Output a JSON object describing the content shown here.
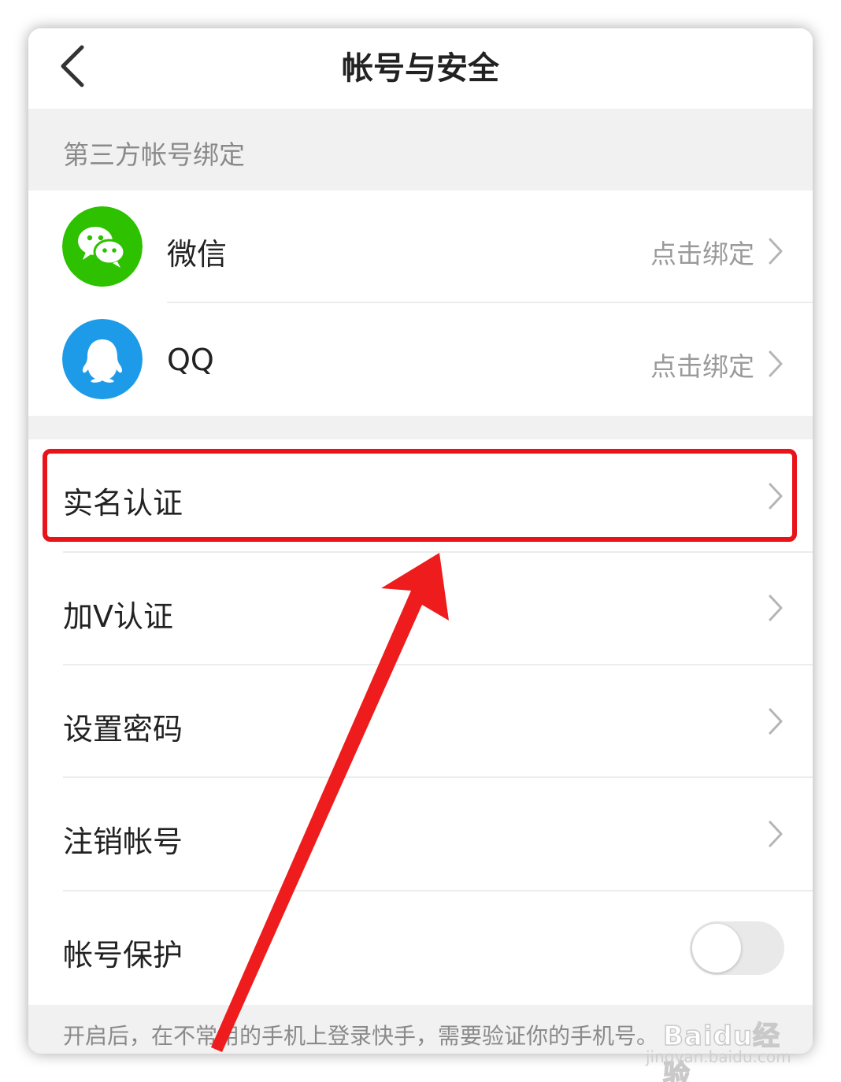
{
  "header": {
    "title": "帐号与安全"
  },
  "third_party": {
    "section_title": "第三方帐号绑定",
    "items": [
      {
        "label": "微信",
        "action": "点击绑定",
        "icon": "wechat-icon",
        "color": "#2dc100"
      },
      {
        "label": "QQ",
        "action": "点击绑定",
        "icon": "qq-icon",
        "color": "#1e9be8"
      }
    ]
  },
  "settings": {
    "items": [
      {
        "label": "实名认证"
      },
      {
        "label": "加V认证"
      },
      {
        "label": "设置密码"
      },
      {
        "label": "注销帐号"
      }
    ],
    "protection": {
      "label": "帐号保护",
      "enabled": false
    }
  },
  "footer": {
    "note": "开启后，在不常用的手机上登录快手，需要验证你的手机号。"
  },
  "watermark": {
    "logo": "Baidu经验",
    "url": "jingyan.baidu.com"
  },
  "colors": {
    "highlight": "#e8141a",
    "background_gray": "#f1f1f1"
  }
}
